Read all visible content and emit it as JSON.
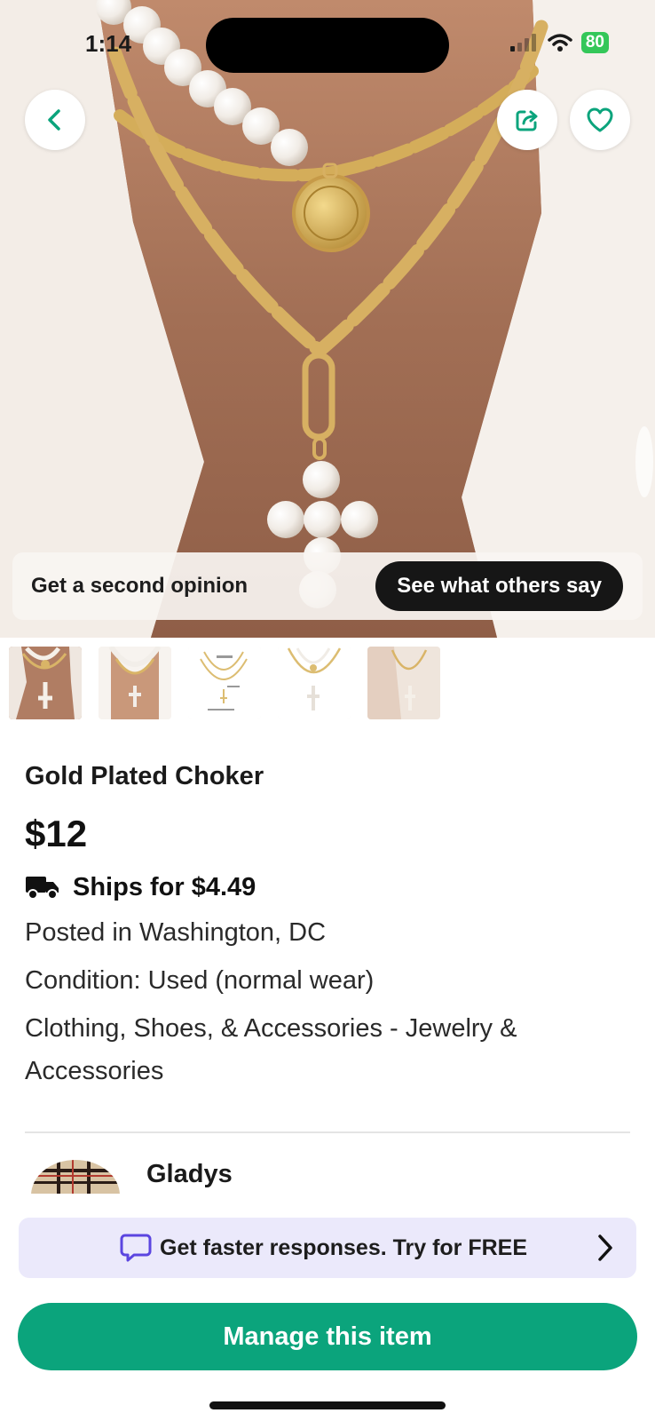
{
  "status_bar": {
    "time": "1:14",
    "battery": "80"
  },
  "hero": {
    "opinion_text": "Get a second opinion",
    "opinion_button": "See what others say"
  },
  "product": {
    "title": "Gold Plated Choker",
    "price": "$12",
    "shipping": "Ships for $4.49",
    "posted": "Posted in Washington, DC",
    "condition": "Condition: Used (normal wear)",
    "category_line1": "Clothing, Shoes, & Accessories - Jewelry &",
    "category_line2": "Accessories"
  },
  "seller": {
    "name": "Gladys"
  },
  "promo": {
    "text": "Get faster responses. Try for FREE"
  },
  "actions": {
    "manage_label": "Manage this item"
  },
  "colors": {
    "accent": "#0ba47c",
    "promo_bg": "#ebe9fb",
    "promo_icon": "#5b45e0"
  },
  "icons": [
    "back-arrow-icon",
    "share-icon",
    "heart-icon",
    "truck-icon",
    "chat-bubble-icon",
    "chevron-right-icon",
    "wifi-icon",
    "signal-icon"
  ]
}
